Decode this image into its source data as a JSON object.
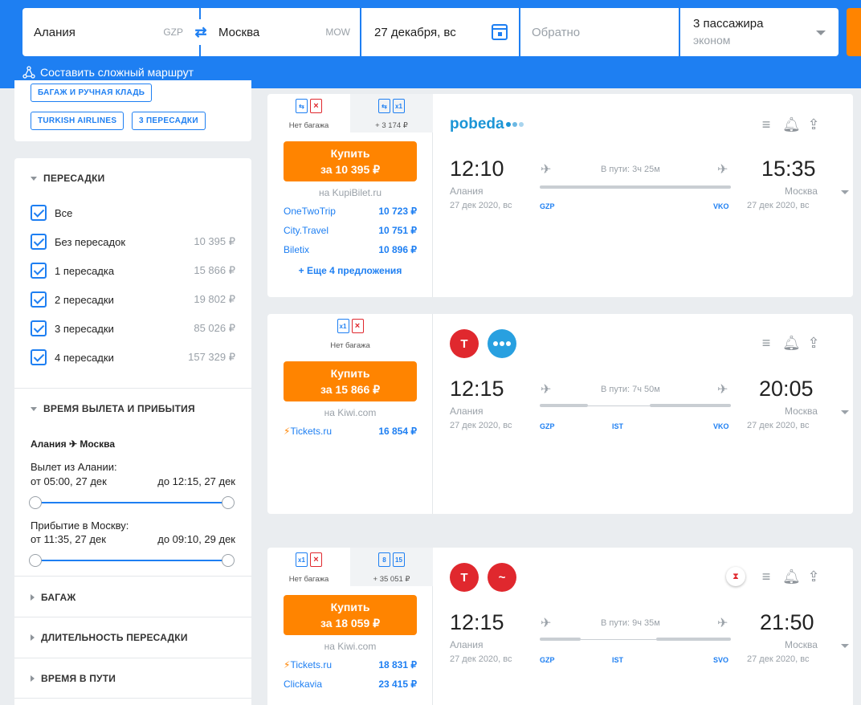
{
  "search": {
    "origin": "Алания",
    "origin_code": "GZP",
    "destination": "Москва",
    "destination_code": "MOW",
    "date": "27 декабря, вс",
    "return_placeholder": "Обратно",
    "passengers": "3 пассажира",
    "cabin": "эконом",
    "complex_route": "Составить сложный маршрут"
  },
  "tags": [
    "БАГАЖ И РУЧНАЯ КЛАДЬ",
    "TURKISH AIRLINES",
    "3 ПЕРЕСАДКИ"
  ],
  "filters": {
    "stops": {
      "title": "ПЕРЕСАДКИ",
      "items": [
        {
          "label": "Все",
          "price": ""
        },
        {
          "label": "Без пересадок",
          "price": "10 395 ₽"
        },
        {
          "label": "1 пересадка",
          "price": "15 866 ₽"
        },
        {
          "label": "2 пересадки",
          "price": "19 802 ₽"
        },
        {
          "label": "3 пересадки",
          "price": "85 026 ₽"
        },
        {
          "label": "4 пересадки",
          "price": "157 329 ₽"
        }
      ]
    },
    "times": {
      "title": "ВРЕМЯ ВЫЛЕТА И ПРИБЫТИЯ",
      "route_from": "Алания",
      "route_to": "Москва",
      "dep_label": "Вылет из Алании:",
      "dep_from": "от 05:00, 27 дек",
      "dep_to": "до 12:15, 27 дек",
      "arr_label": "Прибытие в Москву:",
      "arr_from": "от 11:35, 27 дек",
      "arr_to": "до 09:10, 29 дек"
    },
    "collapsed": [
      "БАГАЖ",
      "ДЛИТЕЛЬНОСТЬ ПЕРЕСАДКИ",
      "ВРЕМЯ В ПУТИ"
    ]
  },
  "tickets": [
    {
      "bag_main": "Нет багажа",
      "bag_alt": "+ 3 174 ₽",
      "buy_line1": "Купить",
      "buy_line2": "за 10 395 ₽",
      "via": "на KupiBilet.ru",
      "offers": [
        {
          "name": "OneTwoTrip",
          "price": "10 723 ₽"
        },
        {
          "name": "City.Travel",
          "price": "10 751 ₽"
        },
        {
          "name": "Biletix",
          "price": "10 896 ₽"
        }
      ],
      "more": "+ Еще 4 предложения",
      "airline_logo": "pobeda",
      "dep_time": "12:10",
      "dep_city": "Алания",
      "dep_date": "27 дек 2020, вс",
      "arr_time": "15:35",
      "arr_city": "Москва",
      "arr_date": "27 дек 2020, вс",
      "duration": "В пути: 3ч 25м",
      "airports": [
        "GZP",
        "VKO"
      ]
    },
    {
      "bag_main": "Нет багажа",
      "buy_line1": "Купить",
      "buy_line2": "за 15 866 ₽",
      "via": "на Kiwi.com",
      "offers": [
        {
          "name": "Tickets.ru",
          "price": "16 854 ₽"
        }
      ],
      "dep_time": "12:15",
      "dep_city": "Алания",
      "dep_date": "27 дек 2020, вс",
      "arr_time": "20:05",
      "arr_city": "Москва",
      "arr_date": "27 дек 2020, вс",
      "duration": "В пути: 7ч 50м",
      "airports": [
        "GZP",
        "IST",
        "VKO"
      ]
    },
    {
      "bag_main": "Нет багажа",
      "bag_alt": "+ 35 051 ₽",
      "bag_alt_icons": [
        "8",
        "15"
      ],
      "buy_line1": "Купить",
      "buy_line2": "за 18 059 ₽",
      "via": "на Kiwi.com",
      "offers": [
        {
          "name": "Tickets.ru",
          "price": "18 831 ₽"
        },
        {
          "name": "Clickavia",
          "price": "23 415 ₽"
        }
      ],
      "dep_time": "12:15",
      "dep_city": "Алания",
      "dep_date": "27 дек 2020, вс",
      "arr_time": "21:50",
      "arr_city": "Москва",
      "arr_date": "27 дек 2020, вс",
      "duration": "В пути: 9ч 35м",
      "airports": [
        "GZP",
        "IST",
        "SVO"
      ]
    }
  ],
  "colors": {
    "brand": "#1e7ff2",
    "buy": "#ff8400",
    "turkish": "#e0282e",
    "pobeda": "#1b95d6"
  }
}
